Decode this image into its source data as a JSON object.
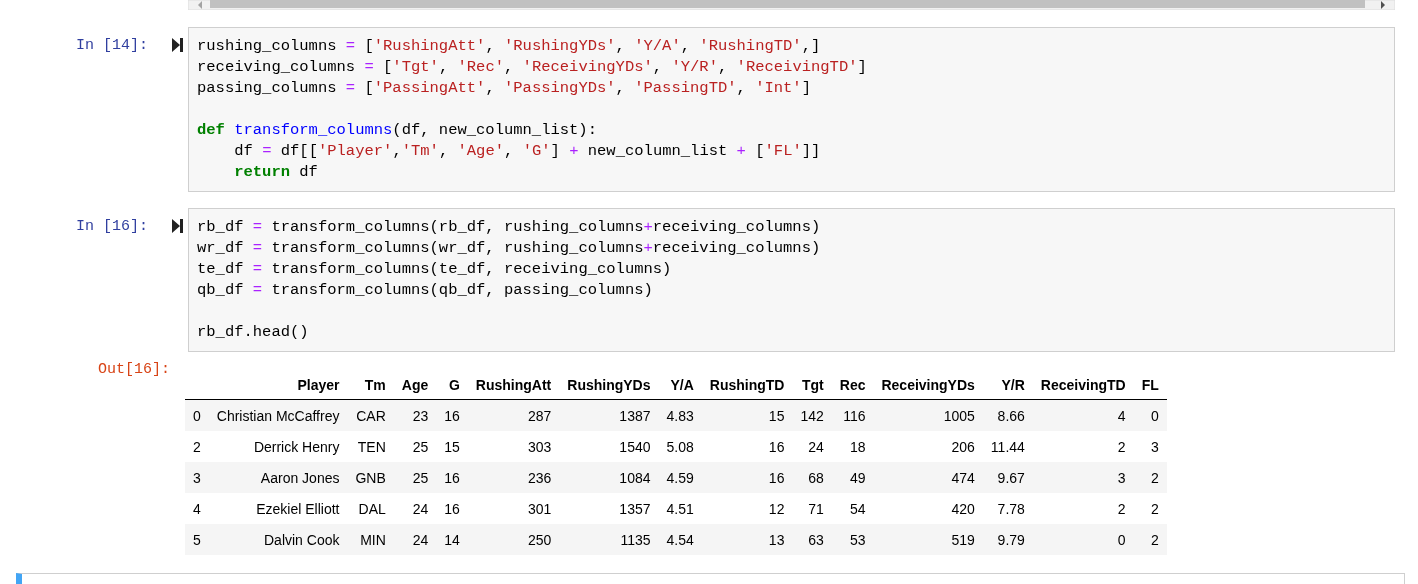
{
  "cells": [
    {
      "prompt": "In [14]:",
      "lines": [
        [
          {
            "kind": "n",
            "text": "rushing_columns "
          },
          {
            "kind": "o",
            "text": "="
          },
          {
            "kind": "n",
            "text": " ["
          },
          {
            "kind": "s",
            "text": "'RushingAtt'"
          },
          {
            "kind": "n",
            "text": ", "
          },
          {
            "kind": "s",
            "text": "'RushingYDs'"
          },
          {
            "kind": "n",
            "text": ", "
          },
          {
            "kind": "s",
            "text": "'Y/A'"
          },
          {
            "kind": "n",
            "text": ", "
          },
          {
            "kind": "s",
            "text": "'RushingTD'"
          },
          {
            "kind": "n",
            "text": ",]"
          }
        ],
        [
          {
            "kind": "n",
            "text": "receiving_columns "
          },
          {
            "kind": "o",
            "text": "="
          },
          {
            "kind": "n",
            "text": " ["
          },
          {
            "kind": "s",
            "text": "'Tgt'"
          },
          {
            "kind": "n",
            "text": ", "
          },
          {
            "kind": "s",
            "text": "'Rec'"
          },
          {
            "kind": "n",
            "text": ", "
          },
          {
            "kind": "s",
            "text": "'ReceivingYDs'"
          },
          {
            "kind": "n",
            "text": ", "
          },
          {
            "kind": "s",
            "text": "'Y/R'"
          },
          {
            "kind": "n",
            "text": ", "
          },
          {
            "kind": "s",
            "text": "'ReceivingTD'"
          },
          {
            "kind": "n",
            "text": "]"
          }
        ],
        [
          {
            "kind": "n",
            "text": "passing_columns "
          },
          {
            "kind": "o",
            "text": "="
          },
          {
            "kind": "n",
            "text": " ["
          },
          {
            "kind": "s",
            "text": "'PassingAtt'"
          },
          {
            "kind": "n",
            "text": ", "
          },
          {
            "kind": "s",
            "text": "'PassingYDs'"
          },
          {
            "kind": "n",
            "text": ", "
          },
          {
            "kind": "s",
            "text": "'PassingTD'"
          },
          {
            "kind": "n",
            "text": ", "
          },
          {
            "kind": "s",
            "text": "'Int'"
          },
          {
            "kind": "n",
            "text": "]"
          }
        ],
        {
          "kind": "blank"
        },
        [
          {
            "kind": "k",
            "text": "def"
          },
          {
            "kind": "f",
            "text": " transform_columns"
          },
          {
            "kind": "n",
            "text": "(df, new_column_list):"
          }
        ],
        [
          {
            "kind": "n",
            "text": "    df "
          },
          {
            "kind": "o",
            "text": "="
          },
          {
            "kind": "n",
            "text": " df[["
          },
          {
            "kind": "s",
            "text": "'Player'"
          },
          {
            "kind": "n",
            "text": ","
          },
          {
            "kind": "s",
            "text": "'Tm'"
          },
          {
            "kind": "n",
            "text": ", "
          },
          {
            "kind": "s",
            "text": "'Age'"
          },
          {
            "kind": "n",
            "text": ", "
          },
          {
            "kind": "s",
            "text": "'G'"
          },
          {
            "kind": "n",
            "text": "] "
          },
          {
            "kind": "o",
            "text": "+"
          },
          {
            "kind": "n",
            "text": " new_column_list "
          },
          {
            "kind": "o",
            "text": "+"
          },
          {
            "kind": "n",
            "text": " ["
          },
          {
            "kind": "s",
            "text": "'FL'"
          },
          {
            "kind": "n",
            "text": "]]"
          }
        ],
        [
          {
            "kind": "k",
            "text": "    return"
          },
          {
            "kind": "n",
            "text": " df"
          }
        ]
      ]
    },
    {
      "prompt": "In [16]:",
      "lines": [
        [
          {
            "kind": "n",
            "text": "rb_df "
          },
          {
            "kind": "o",
            "text": "="
          },
          {
            "kind": "n",
            "text": " transform_columns(rb_df, rushing_columns"
          },
          {
            "kind": "o",
            "text": "+"
          },
          {
            "kind": "n",
            "text": "receiving_columns)"
          }
        ],
        [
          {
            "kind": "n",
            "text": "wr_df "
          },
          {
            "kind": "o",
            "text": "="
          },
          {
            "kind": "n",
            "text": " transform_columns(wr_df, rushing_columns"
          },
          {
            "kind": "o",
            "text": "+"
          },
          {
            "kind": "n",
            "text": "receiving_columns)"
          }
        ],
        [
          {
            "kind": "n",
            "text": "te_df "
          },
          {
            "kind": "o",
            "text": "="
          },
          {
            "kind": "n",
            "text": " transform_columns(te_df, receiving_columns)"
          }
        ],
        [
          {
            "kind": "n",
            "text": "qb_df "
          },
          {
            "kind": "o",
            "text": "="
          },
          {
            "kind": "n",
            "text": " transform_columns(qb_df, passing_columns)"
          }
        ],
        {
          "kind": "blank"
        },
        [
          {
            "kind": "n",
            "text": "rb_df.head()"
          }
        ]
      ],
      "output": {
        "prompt": "Out[16]:",
        "table": {
          "columns": [
            "Player",
            "Tm",
            "Age",
            "G",
            "RushingAtt",
            "RushingYDs",
            "Y/A",
            "RushingTD",
            "Tgt",
            "Rec",
            "ReceivingYDs",
            "Y/R",
            "ReceivingTD",
            "FL"
          ],
          "rows": [
            {
              "index": "0",
              "cells": [
                "Christian McCaffrey",
                "CAR",
                "23",
                "16",
                "287",
                "1387",
                "4.83",
                "15",
                "142",
                "116",
                "1005",
                "8.66",
                "4",
                "0"
              ]
            },
            {
              "index": "2",
              "cells": [
                "Derrick Henry",
                "TEN",
                "25",
                "15",
                "303",
                "1540",
                "5.08",
                "16",
                "24",
                "18",
                "206",
                "11.44",
                "2",
                "3"
              ]
            },
            {
              "index": "3",
              "cells": [
                "Aaron Jones",
                "GNB",
                "25",
                "16",
                "236",
                "1084",
                "4.59",
                "16",
                "68",
                "49",
                "474",
                "9.67",
                "3",
                "2"
              ]
            },
            {
              "index": "4",
              "cells": [
                "Ezekiel Elliott",
                "DAL",
                "24",
                "16",
                "301",
                "1357",
                "4.51",
                "12",
                "71",
                "54",
                "420",
                "7.78",
                "2",
                "2"
              ]
            },
            {
              "index": "5",
              "cells": [
                "Dalvin Cook",
                "MIN",
                "24",
                "14",
                "250",
                "1135",
                "4.54",
                "13",
                "63",
                "53",
                "519",
                "9.79",
                "0",
                "2"
              ]
            }
          ]
        }
      }
    }
  ]
}
